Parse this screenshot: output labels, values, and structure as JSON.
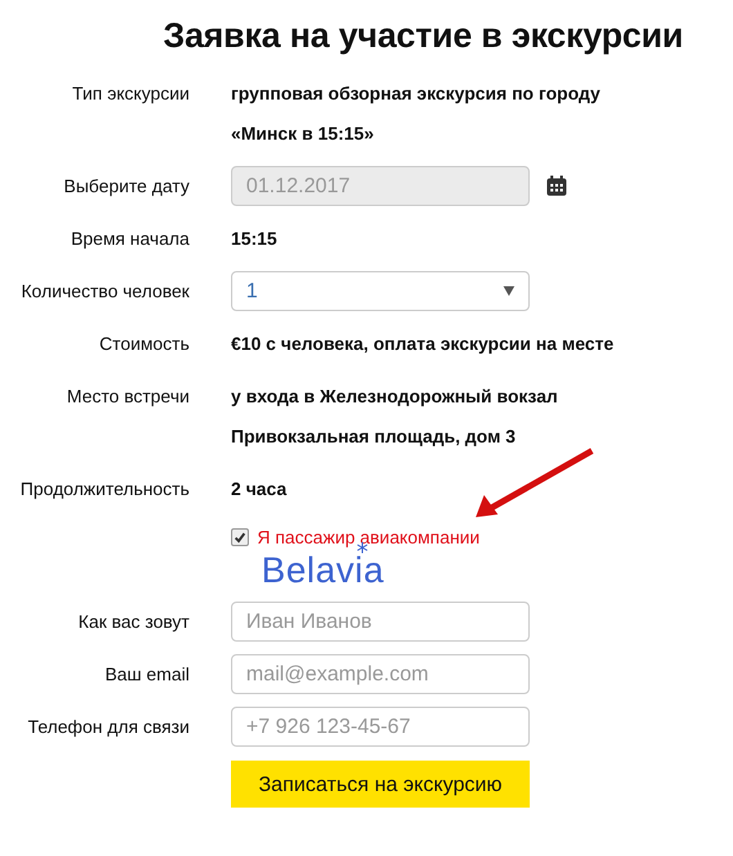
{
  "title": "Заявка на участие в экскурсии",
  "rows": [
    {
      "kind": "text",
      "label": "Тип экскурсии",
      "lines": [
        "групповая обзорная экскурсия по городу",
        "«Минск в 15:15»"
      ]
    },
    {
      "kind": "date",
      "label": "Выберите дату",
      "value": "01.12.2017",
      "disabled": true
    },
    {
      "kind": "text",
      "label": "Время начала",
      "lines": [
        "15:15"
      ]
    },
    {
      "kind": "select",
      "label": "Количество человек",
      "value": "1"
    },
    {
      "kind": "text",
      "label": "Стоимость",
      "lines": [
        "€10 с человека, оплата экскурсии на месте"
      ]
    },
    {
      "kind": "text",
      "label": "Место встречи",
      "lines": [
        "у входа в Железнодорожный вокзал",
        "Привокзальная площадь, дом 3"
      ]
    },
    {
      "kind": "text",
      "label": "Продолжительность",
      "lines": [
        "2 часа"
      ]
    },
    {
      "kind": "checkbox",
      "text": "Я пассажир авиакомпании",
      "checked": true,
      "logo": "Belavia"
    },
    {
      "kind": "input",
      "label": "Как вас зовут",
      "placeholder": "Иван Иванов"
    },
    {
      "kind": "input",
      "label": "Ваш email",
      "placeholder": "mail@example.com"
    },
    {
      "kind": "input",
      "label": "Телефон для связи",
      "placeholder": "+7 926 123-45-67"
    }
  ],
  "submit": "Записаться на экскурсию"
}
